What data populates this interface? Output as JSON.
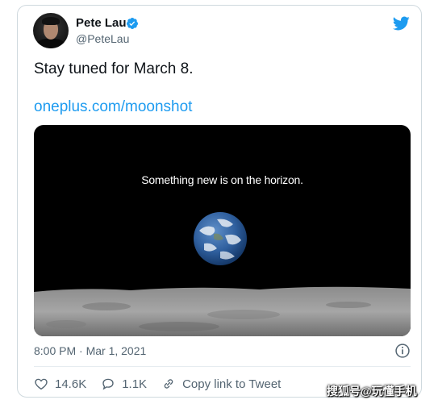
{
  "tweet": {
    "author_name": "Pete Lau",
    "handle": "@PeteLau",
    "verified": true,
    "text": "Stay tuned for March 8.",
    "link": "oneplus.com/moonshot",
    "media_caption": "Something new is on the horizon.",
    "timestamp": "8:00 PM · Mar 1, 2021"
  },
  "actions": {
    "likes": "14.6K",
    "replies": "1.1K",
    "copy_link_label": "Copy link to Tweet"
  },
  "watermark": "搜狐号@玩懂手机",
  "icons": {
    "verified": "verified-badge-icon",
    "brand": "twitter-bird-icon",
    "info": "info-icon",
    "like": "heart-icon",
    "reply": "reply-bubble-icon",
    "copy_link": "link-icon"
  },
  "colors": {
    "link": "#1d9bf0",
    "secondary_text": "#536471",
    "border": "#cfd9de"
  }
}
